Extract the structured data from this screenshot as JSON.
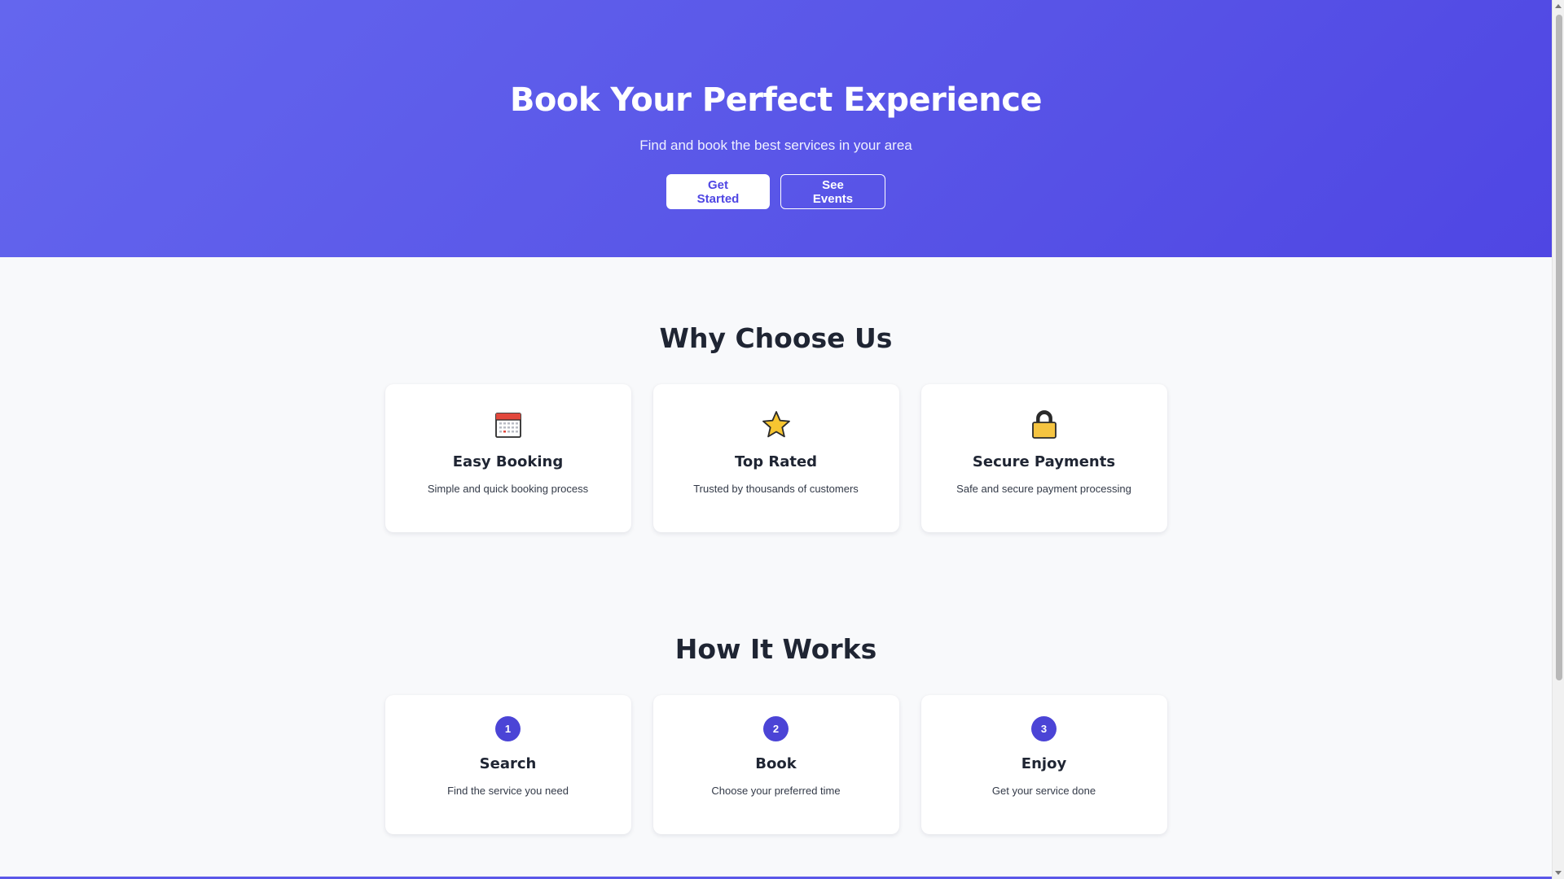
{
  "hero": {
    "title": "Book Your Perfect Experience",
    "subtitle": "Find and book the best services in your area",
    "primary_button": "Get Started",
    "secondary_button": "See Events",
    "gradient_colors": [
      "#6466ee",
      "#4f46e3"
    ]
  },
  "why": {
    "title": "Why Choose Us",
    "features": [
      {
        "icon": "calendar-icon",
        "title": "Easy Booking",
        "description": "Simple and quick booking process"
      },
      {
        "icon": "star-icon",
        "title": "Top Rated",
        "description": "Trusted by thousands of customers"
      },
      {
        "icon": "lock-icon",
        "title": "Secure Payments",
        "description": "Safe and secure payment processing"
      }
    ]
  },
  "how": {
    "title": "How It Works",
    "steps": [
      {
        "number": "1",
        "title": "Search",
        "description": "Find the service you need"
      },
      {
        "number": "2",
        "title": "Book",
        "description": "Choose your preferred time"
      },
      {
        "number": "3",
        "title": "Enjoy",
        "description": "Get your service done"
      }
    ]
  },
  "colors": {
    "accent": "#4f46e3",
    "badge": "#4b44d6",
    "background": "#f8f9fb",
    "text": "#1f2533"
  }
}
